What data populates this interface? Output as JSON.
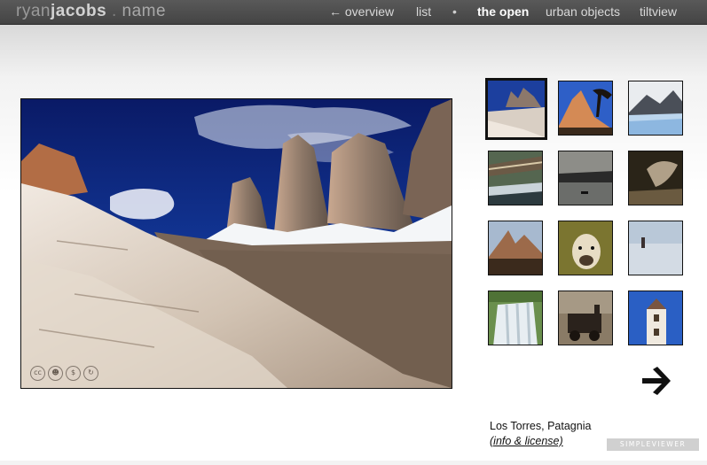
{
  "site": {
    "logo_parts": [
      "ryan",
      "jacobs",
      " . ",
      "name"
    ]
  },
  "nav": {
    "items": [
      {
        "label": "← overview",
        "active": false
      },
      {
        "label": "list",
        "active": false
      },
      {
        "label": "•",
        "active": false
      },
      {
        "label": "the open",
        "active": true
      },
      {
        "label": "urban objects",
        "active": false
      },
      {
        "label": "tiltview",
        "active": false
      }
    ]
  },
  "gallery": {
    "selected_index": 0,
    "main_image": "Los Torres, Patagnia mountain photo",
    "license_icons": [
      "cc-icon",
      "by-icon",
      "nc-icon",
      "sa-icon"
    ],
    "thumbnails": [
      "torres-thumbnail",
      "mountain-tree-thumbnail",
      "glacier-thumbnail",
      "bridge-river-thumbnail",
      "sunset-lake-thumbnail",
      "rock-formation-thumbnail",
      "fitzroy-thumbnail",
      "llama-thumbnail",
      "salt-flat-walker-thumbnail",
      "waterfall-thumbnail",
      "train-wreck-thumbnail",
      "church-tower-thumbnail"
    ]
  },
  "caption": {
    "title": "Los Torres, Patagnia",
    "link_label": "(info & license)"
  },
  "badge": {
    "label": "SIMPLEVIEWER"
  },
  "colors": {
    "topbar": "#4a4a4a",
    "thumb_border": "#111111",
    "accent_text": "#ffffff"
  }
}
